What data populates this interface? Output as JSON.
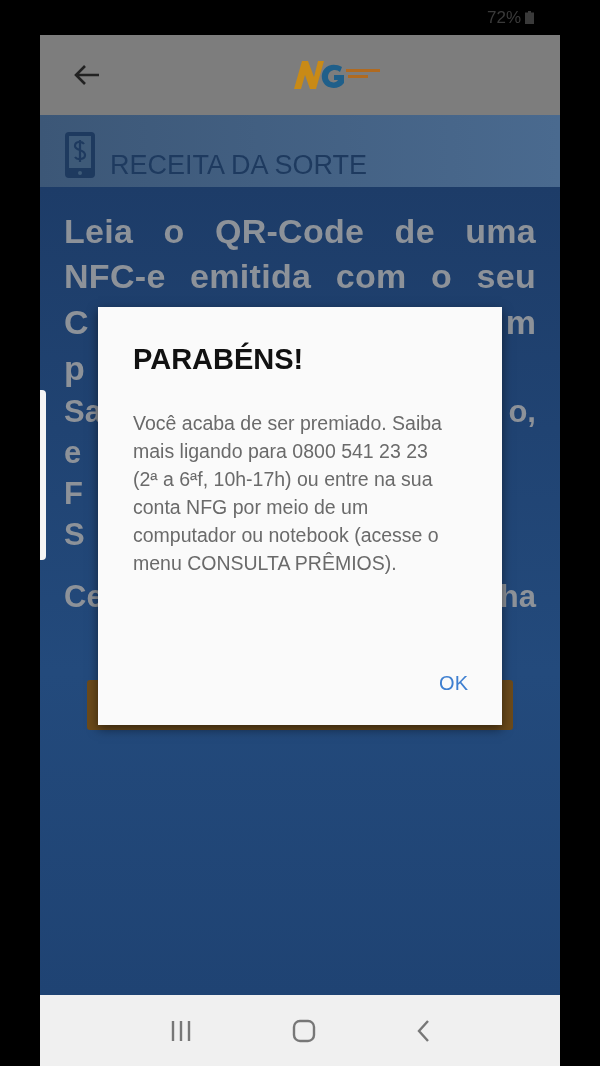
{
  "status_bar": {
    "battery": "72%"
  },
  "header": {
    "title": "RECEITA DA SORTE"
  },
  "background_text": {
    "lines": [
      "Leia o QR-Code de uma",
      "NFC-e emitida com o seu"
    ],
    "fragments": [
      {
        "left": "C",
        "right": "m"
      },
      {
        "left": "p"
      },
      {
        "left": "Sa",
        "right": "o,"
      },
      {
        "left": "e"
      },
      {
        "left": "F"
      },
      {
        "left": "S"
      },
      {
        "left": "Ce",
        "right": "ha"
      }
    ]
  },
  "dialog": {
    "title": "PARABÉNS!",
    "message": "Você acaba de ser premiado. Saiba mais ligando para 0800 541 23 23 (2ª a 6ªf, 10h-17h) ou entre na sua conta NFG por meio de um computador ou notebook (acesse o menu CONSULTA PRÊMIOS).",
    "button": "OK"
  }
}
